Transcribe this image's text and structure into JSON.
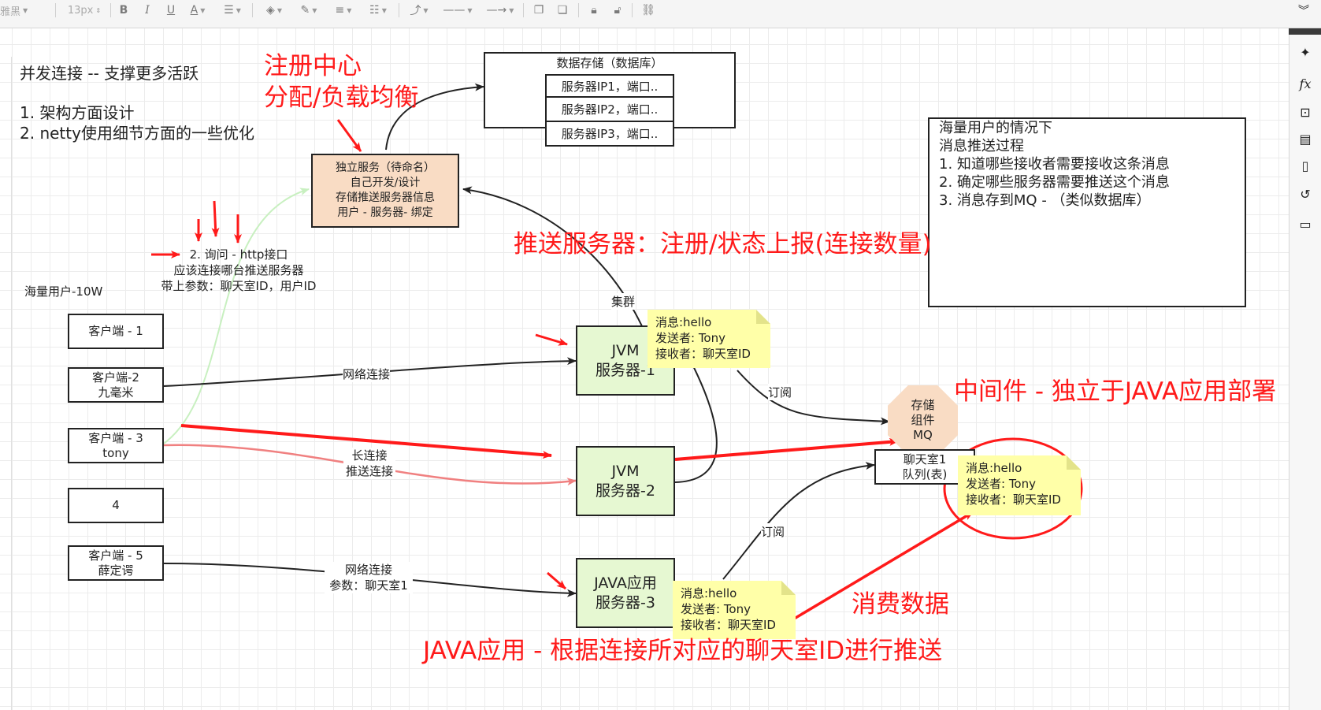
{
  "toolbar": {
    "font_name": "雅黑",
    "font_size": "13px",
    "bold": "B",
    "italic": "I",
    "underline": "U",
    "font_color": "A"
  },
  "title_block": {
    "line1": "并发连接 -- 支撑更多活跃",
    "line2": "1. 架构方面设计",
    "line3": "2. netty使用细节方面的一些优化"
  },
  "annotations": {
    "registry": "注册中心",
    "load_balance": "分配/负载均衡",
    "push_server": "推送服务器：注册/状态上报(连接数量)",
    "middleware": "中间件 - 独立于JAVA应用部署",
    "consume": "消费数据",
    "java_push": "JAVA应用 - 根据连接所对应的聊天室ID进行推送"
  },
  "database": {
    "title": "数据存储（数据库）",
    "rows": [
      "服务器IP1，端口..",
      "服务器IP2，端口..",
      "服务器IP3，端口.."
    ]
  },
  "service_box": {
    "lines": [
      "独立服务（待命名）",
      "自己开发/设计",
      "存储推送服务器信息",
      "用户 - 服务器- 绑定"
    ]
  },
  "massive_users_box": {
    "lines": [
      "海量用户的情况下",
      "消息推送过程",
      "1.  知道哪些接收者需要接收这条消息",
      "2.  确定哪些服务器需要推送这个消息",
      "3. 消息存到MQ -  （类似数据库）"
    ]
  },
  "query_label": {
    "lines": [
      "2. 询问 - http接口",
      "应该连接哪台推送服务器",
      "带上参数：聊天室ID，用户ID"
    ]
  },
  "users_label": "海量用户-10W",
  "clients": [
    {
      "lines": [
        "客户端 - 1"
      ]
    },
    {
      "lines": [
        "客户端-2",
        "九毫米"
      ]
    },
    {
      "lines": [
        "客户端 - 3",
        "tony"
      ]
    },
    {
      "lines": [
        "4"
      ]
    },
    {
      "lines": [
        "客户端 - 5",
        "薛定谔"
      ]
    }
  ],
  "servers": [
    {
      "lines": [
        "JVM",
        "服务器-1"
      ]
    },
    {
      "lines": [
        "JVM",
        "服务器-2"
      ]
    },
    {
      "lines": [
        "JAVA应用",
        "服务器-3"
      ]
    }
  ],
  "mq": {
    "lines": [
      "存储",
      "组件",
      "MQ"
    ]
  },
  "chatroom_queue": {
    "lines": [
      "聊天室1",
      "队列(表)"
    ]
  },
  "note": {
    "lines": [
      "消息:hello",
      "发送者: Tony",
      "接收者：聊天室ID"
    ]
  },
  "edge_labels": {
    "cluster": "集群",
    "net1": "网络连接",
    "subscribe1": "订阅",
    "long_conn": [
      "长连接",
      "推送连接"
    ],
    "subscribe2": "订阅",
    "net2": [
      "网络连接",
      "参数：聊天室1"
    ]
  },
  "right_panel_icons": [
    "navigate-icon",
    "formula-icon",
    "shape-edit-icon",
    "pages-icon",
    "page-icon",
    "history-icon",
    "comment-icon"
  ]
}
